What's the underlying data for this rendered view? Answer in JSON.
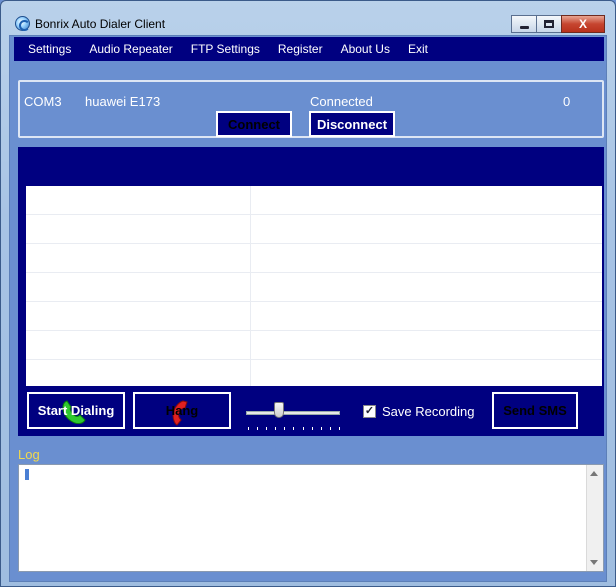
{
  "window": {
    "title": "Bonrix Auto Dialer Client"
  },
  "titlebar": {
    "close_glyph": "X"
  },
  "menu": [
    {
      "label": "Settings"
    },
    {
      "label": "Audio Repeater"
    },
    {
      "label": "FTP Settings"
    },
    {
      "label": "Register"
    },
    {
      "label": "About Us"
    },
    {
      "label": "Exit"
    }
  ],
  "connection": {
    "port": "COM3",
    "device": "huawei E173",
    "status": "Connected",
    "count": "0",
    "connect_label": "Connect",
    "disconnect_label": "Disconnect"
  },
  "controls": {
    "start_label": "Start Dialing",
    "hang_label": "Hang",
    "send_sms_label": "Send SMS",
    "save_recording_label": "Save Recording",
    "save_recording_checked": true,
    "check_glyph": "✓",
    "volume_level": 0.33
  },
  "log": {
    "label": "Log"
  },
  "colors": {
    "accent": "#000080",
    "panel": "#6a8fd0",
    "log_label": "#f2d94c"
  }
}
